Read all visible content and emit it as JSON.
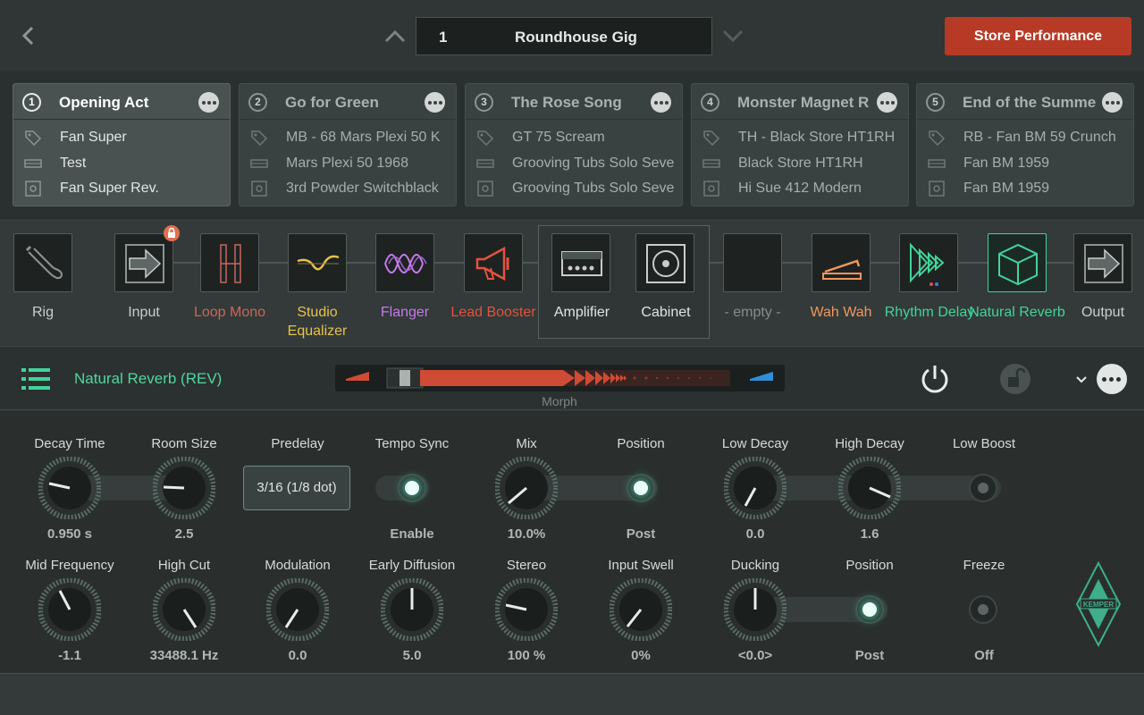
{
  "header": {
    "performance_number": "1",
    "performance_name": "Roundhouse Gig",
    "store_label": "Store Performance"
  },
  "slots": [
    {
      "num": "1",
      "title": "Opening Act",
      "rig": "Fan Super",
      "amp": "Test",
      "cab": "Fan Super Rev.",
      "active": true
    },
    {
      "num": "2",
      "title": "Go for Green",
      "rig": "MB - 68 Mars Plexi 50 K",
      "amp": "Mars Plexi 50 1968",
      "cab": "3rd Powder Switchblack",
      "active": false
    },
    {
      "num": "3",
      "title": "The Rose Song",
      "rig": "GT 75 Scream",
      "amp": "Grooving Tubs Solo Seve",
      "cab": "Grooving Tubs Solo Seve",
      "active": false
    },
    {
      "num": "4",
      "title": "Monster Magnet R",
      "rig": "TH - Black Store HT1RH",
      "amp": "Black Store HT1RH",
      "cab": "Hi Sue 412 Modern",
      "active": false
    },
    {
      "num": "5",
      "title": "End of the Summe",
      "rig": "RB - Fan BM 59 Crunch",
      "amp": "Fan BM 1959",
      "cab": "Fan BM 1959",
      "active": false
    }
  ],
  "chain": {
    "rig": "Rig",
    "input": "Input",
    "loop_mono": "Loop Mono",
    "studio_equalizer": "Studio Equalizer",
    "flanger": "Flanger",
    "lead_booster": "Lead Booster",
    "amplifier": "Amplifier",
    "cabinet": "Cabinet",
    "empty": "- empty -",
    "wah_wah": "Wah Wah",
    "rhythm_delay": "Rhythm Delay",
    "natural_reverb": "Natural Reverb",
    "output": "Output"
  },
  "module": {
    "title": "Natural Reverb (REV)",
    "morph_label": "Morph",
    "morph_level": 0.0
  },
  "params": {
    "decay_time": {
      "label": "Decay Time",
      "value": "0.950 s"
    },
    "room_size": {
      "label": "Room Size",
      "value": "2.5"
    },
    "predelay": {
      "label": "Predelay",
      "value": "3/16 (1/8 dot)"
    },
    "tempo_sync": {
      "label": "Tempo Sync",
      "value": "Enable"
    },
    "mix": {
      "label": "Mix",
      "value": "10.0%"
    },
    "position1": {
      "label": "Position",
      "value": "Post"
    },
    "low_decay": {
      "label": "Low Decay",
      "value": "0.0"
    },
    "high_decay": {
      "label": "High Decay",
      "value": "1.6"
    },
    "low_boost": {
      "label": "Low Boost",
      "value": ""
    },
    "mid_frequency": {
      "label": "Mid Frequency",
      "value": "-1.1"
    },
    "high_cut": {
      "label": "High Cut",
      "value": "33488.1 Hz"
    },
    "modulation": {
      "label": "Modulation",
      "value": "0.0"
    },
    "early_diffusion": {
      "label": "Early Diffusion",
      "value": "5.0"
    },
    "stereo": {
      "label": "Stereo",
      "value": "100 %"
    },
    "input_swell": {
      "label": "Input Swell",
      "value": "0%"
    },
    "ducking": {
      "label": "Ducking",
      "value": "<0.0>"
    },
    "position2": {
      "label": "Position",
      "value": "Post"
    },
    "freeze": {
      "label": "Freeze",
      "value": "Off"
    }
  },
  "colors": {
    "accent_green": "#4fd6a0",
    "store_red": "#b63a26",
    "loop_mono": "#c9675a",
    "studio_eq": "#e8c24a",
    "flanger": "#c47be8",
    "lead_booster": "#e2533f",
    "wah": "#f0965c",
    "delay": "#43d39a"
  },
  "brand": "KEMPER"
}
